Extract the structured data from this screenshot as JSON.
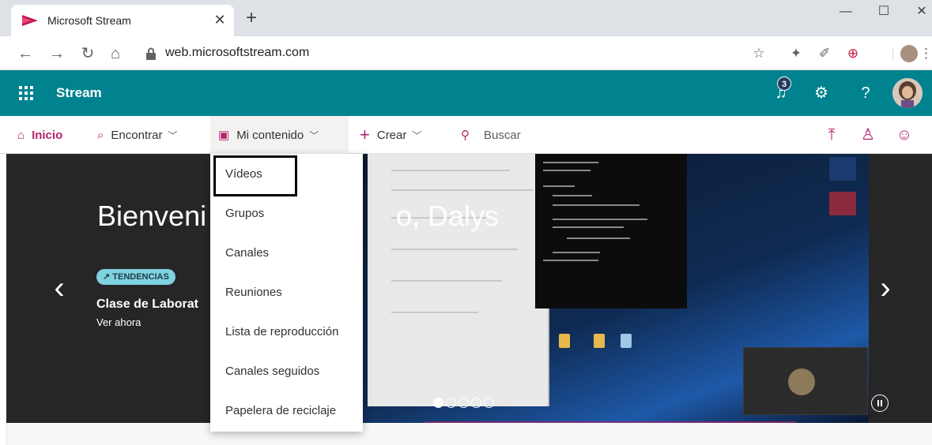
{
  "browser": {
    "tab_title": "Microsoft Stream",
    "url": "web.microsoftstream.com"
  },
  "header": {
    "brand": "Stream",
    "notification_count": "3",
    "help_label": "?"
  },
  "nav": {
    "home": "Inicio",
    "discover": "Encontrar",
    "my_content": "Mi contenido",
    "create": "Crear",
    "search": "Buscar"
  },
  "hero": {
    "title": "Bienvenido de nuevo, Dalys",
    "title_visible_left": "Bienveni",
    "title_visible_right": "o, Dalys",
    "badge": "TENDENCIAS",
    "video_title": "Clase de Laborat",
    "watch_label": "Ver ahora",
    "slide_count": 5,
    "active_slide": 1
  },
  "dropdown": {
    "items": [
      "Vídeos",
      "Grupos",
      "Canales",
      "Reuniones",
      "Lista de reproducción",
      "Canales seguidos",
      "Papelera de reciclaje"
    ]
  },
  "colors": {
    "header_teal": "#00838f",
    "accent_magenta": "#b4236c",
    "hero_dark": "#262626",
    "badge_cyan": "#7fd3e0"
  }
}
